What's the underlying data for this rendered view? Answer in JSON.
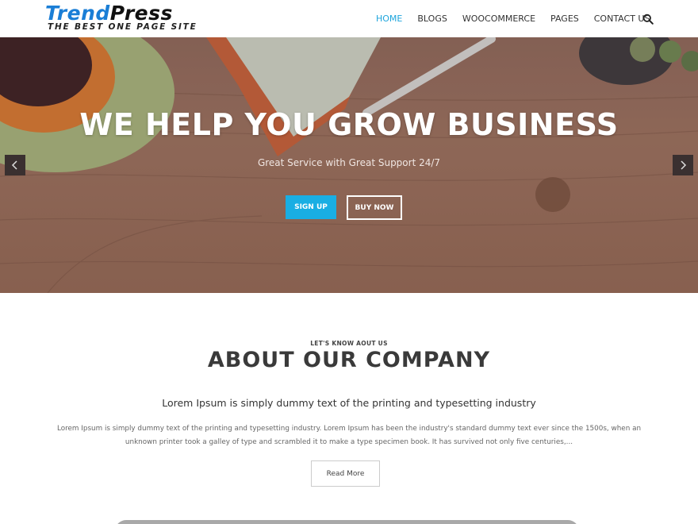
{
  "header": {
    "logo_part1": "Trend",
    "logo_part2": "Press",
    "tagline": "The Best One Page Site",
    "nav": [
      "HOME",
      "BLOGS",
      "WOOCOMMERCE",
      "PAGES",
      "CONTACT US"
    ],
    "active_nav": "HOME",
    "search_icon": "search-icon"
  },
  "hero": {
    "title": "WE HELP YOU GROW BUSINESS",
    "subtitle": "Great Service with Great Support 24/7",
    "primary_button": "SIGN UP",
    "secondary_button": "BUY NOW",
    "prev_icon": "chevron-left-icon",
    "next_icon": "chevron-right-icon"
  },
  "about": {
    "kicker": "LET'S KNOW AOUT US",
    "title": "ABOUT OUR COMPANY",
    "lead": "Lorem Ipsum is simply dummy text of the printing and typesetting industry",
    "body": "Lorem Ipsum is simply dummy text of the printing and typesetting industry. Lorem Ipsum has been the industry's standard dummy text ever since the 1500s, when an unknown printer took a galley of type and scrambled it to make a type specimen book. It has survived not only five centuries,...",
    "button": "Read More"
  },
  "colors": {
    "accent": "#19aee3",
    "logo_blue": "#1a7ed6",
    "nav_active": "#1ea5dc"
  }
}
